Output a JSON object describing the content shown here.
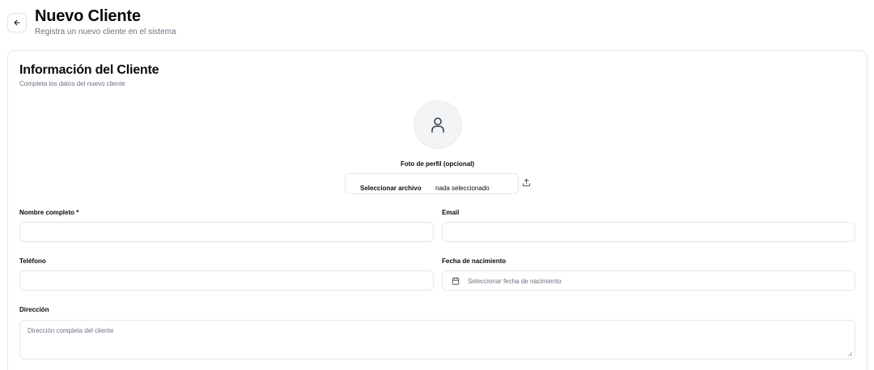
{
  "header": {
    "back_icon": "arrow-left-icon",
    "title": "Nuevo Cliente",
    "subtitle": "Registra un nuevo cliente en el sistema"
  },
  "card": {
    "title": "Información del Cliente",
    "description": "Completa los datos del nuevo cliente"
  },
  "photo": {
    "avatar_icon": "user-icon",
    "label": "Foto de perfil (opcional)",
    "file_button_label": "Seleccionar archivo",
    "file_status": "nada seleccionado",
    "upload_icon": "upload-icon"
  },
  "fields": {
    "full_name": {
      "label": "Nombre completo *",
      "value": ""
    },
    "email": {
      "label": "Email",
      "value": ""
    },
    "phone": {
      "label": "Teléfono",
      "value": ""
    },
    "birth_date": {
      "label": "Fecha de nacimiento",
      "placeholder": "Seleccionar fecha de nacimiento",
      "icon": "calendar-icon"
    },
    "address": {
      "label": "Dirección",
      "placeholder": "Dirección completa del cliente"
    }
  },
  "colors": {
    "border": "#e5e7eb",
    "muted_text": "#6b7280",
    "avatar_bg": "#f3f4f6",
    "text": "#0a0a0a"
  }
}
